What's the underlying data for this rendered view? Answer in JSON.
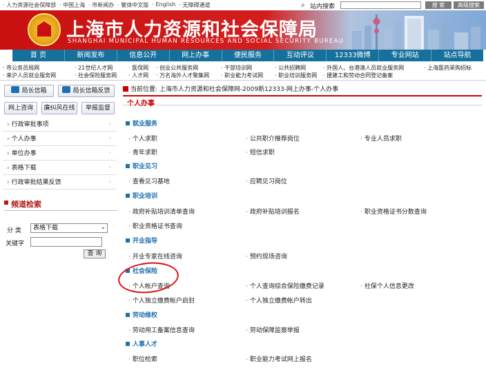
{
  "topbar": {
    "links": [
      "· 人力资源社会保障部",
      "· 中国上海",
      "· 市新闻办",
      "· 繁体中文版",
      "· English",
      "· 无障碍通道"
    ],
    "search_label": "站内搜索",
    "search_placeholder": "",
    "search_button": "搜 索",
    "advanced_button": "高级搜索"
  },
  "banner": {
    "title": "上海市人力资源和社会保障局",
    "subtitle": "SHANGHAI MUNICIPAL HUMAN RESOURCES AND SOCIAL SECURITY BUREAU"
  },
  "nav": [
    "首 页",
    "新闻发布",
    "信息公开",
    "网上办事",
    "便民服务",
    "互动评议",
    "12333微博",
    "专业网站",
    "站点导航"
  ],
  "sublinks": {
    "row1": [
      "· 市公务员局网",
      "· 21世纪人才网",
      "· 医保网",
      "· 创业公共服务网",
      "· 干部培训网",
      "· 公共招聘网",
      "· 外国人、台港澳人员就业服务网",
      "· 上海医药采购招标"
    ],
    "row2": [
      "· 来沪人员就业服务网",
      "· 社会保险服务网",
      "· 人才网",
      "· 万名海外人才聚集网",
      "· 职业能力考试网",
      "· 职业培训服务网",
      "· 援建工和劳动合同登记备案"
    ]
  },
  "left": {
    "btn_mailbox": "局长信箱",
    "btn_feedback": "局长信箱反馈",
    "btn_consult": "网上咨询",
    "btn_integrity": "廉纠风在线",
    "btn_report": "举报监督",
    "menu": [
      "行政审批事项",
      "个人办事",
      "单位办事",
      "表格下载",
      "行政审批结果反馈"
    ],
    "channel_title": "频道检索",
    "label_category": "分 类",
    "select_value": "表格下载",
    "label_keyword": "关键字",
    "query_button": "查 询"
  },
  "main": {
    "breadcrumb": "当前位置: 上海市人力资源和社会保障网-2009新12333-网上办事-个人办事",
    "section_title": "个人办事",
    "categories": [
      {
        "name": "就业服务",
        "items": [
          "个人求职",
          "公共职介推荐岗位",
          "专业人员求职",
          "青年求职",
          "短信求职"
        ]
      },
      {
        "name": "职业见习",
        "items": [
          "查看见习基地",
          "应聘见习岗位"
        ]
      },
      {
        "name": "职业培训",
        "items": [
          "政府补贴培训清单查询",
          "政府补贴培训报名",
          "职业资格证书分数查询",
          "职业资格证书查询"
        ]
      },
      {
        "name": "开业指导",
        "items": [
          "开业专家在线咨询",
          "预约现场咨询"
        ]
      },
      {
        "name": "社会保险",
        "items": [
          "个人帐户查询",
          "个人查询综合保险缴费记录",
          "社保个人信息更改",
          "个人独立缴费帐户启封",
          "个人独立缴费帐户转出"
        ]
      },
      {
        "name": "劳动维权",
        "items": [
          "劳动用工备案信息查询",
          "劳动保障监察举报"
        ]
      },
      {
        "name": "人事人才",
        "items": [
          "职位检索",
          "职业能力考试网上报名"
        ]
      }
    ]
  },
  "colors": {
    "nav": "#16709c",
    "banner_red": "#c81010",
    "accent_red": "#c00000",
    "link_blue": "#1e6fb0"
  }
}
